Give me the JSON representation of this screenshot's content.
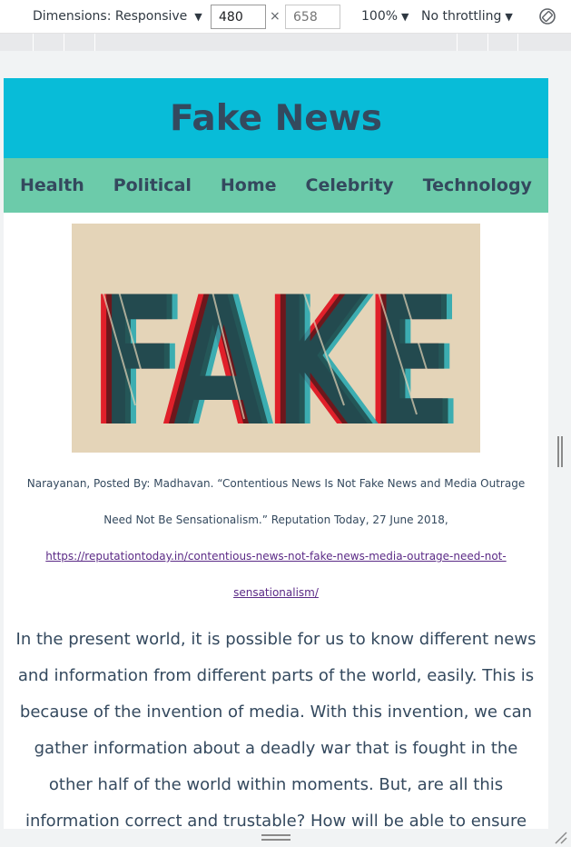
{
  "devtools": {
    "dimensions_label": "Dimensions: Responsive",
    "width_value": "480",
    "height_placeholder": "658",
    "times_sign": "×",
    "zoom_label": "100%",
    "throttle_label": "No throttling",
    "caret": "▼"
  },
  "site": {
    "title": "Fake News",
    "nav": [
      "Health",
      "Political",
      "Home",
      "Celebrity",
      "Technology"
    ],
    "hero_word": "FAKE"
  },
  "citation": {
    "text_line": "Narayanan, Posted By: Madhavan. “Contentious News Is Not Fake News and Media Outrage Need Not Be Sensationalism.” Reputation Today, 27 June 2018,",
    "link": "https://reputationtoday.in/contentious-news-not-fake-news-media-outrage-need-not-sensationalism/"
  },
  "article": {
    "paragraph": "In the present world, it is possible for us to know different news and information from different parts of the world, easily. This is because of the invention of media. With this invention, we can gather information about a deadly war that is fought in the other half of the world within moments. But, are all this information correct and trustable? How will be able to ensure"
  },
  "colors": {
    "header_bg": "#08bcd8",
    "nav_bg": "#6ccbaa",
    "text": "#34495e",
    "link": "#5b2a86",
    "hero_bg": "#e4d4b8",
    "fake_red": "#e0202a",
    "fake_teal": "#1fa7b0",
    "fake_black": "#111111"
  }
}
